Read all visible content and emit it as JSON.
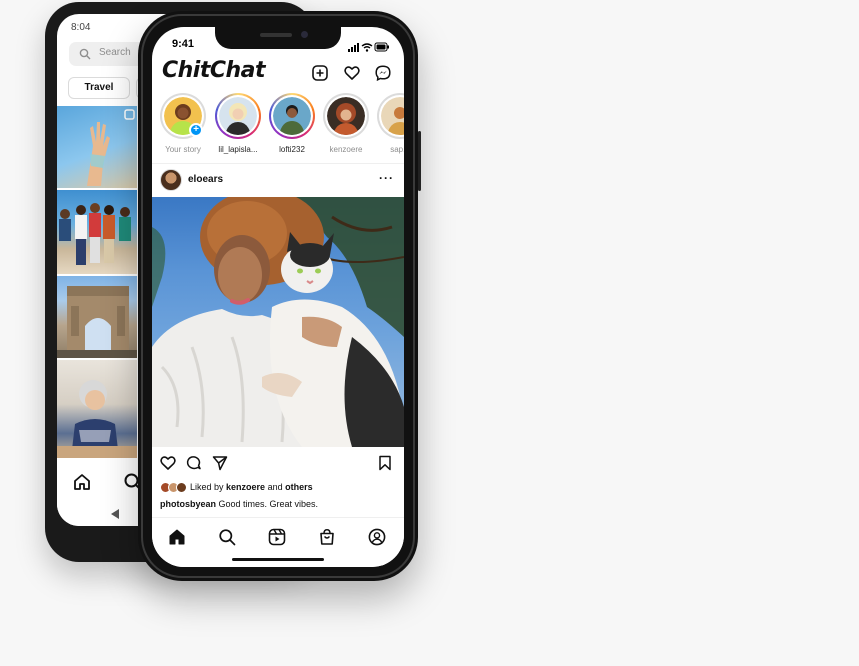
{
  "back_phone": {
    "status_time": "8:04",
    "search": {
      "placeholder": "Search",
      "icon": "search-icon"
    },
    "chips": [
      {
        "label": "Travel"
      }
    ],
    "nav_icons": [
      "home-icon",
      "search-icon",
      "back-triangle-icon"
    ]
  },
  "front_phone": {
    "status_time": "9:41",
    "app_title": "ChitChat",
    "header_icons": [
      "new-post-icon",
      "heart-icon",
      "messenger-icon"
    ],
    "stories": [
      {
        "label": "Your story",
        "own": true
      },
      {
        "label": "lil_lapisla..."
      },
      {
        "label": "lofti232"
      },
      {
        "label": "kenzoere"
      },
      {
        "label": "sap..."
      }
    ],
    "post": {
      "username": "eloears",
      "more": "···",
      "liked_prefix": "Liked by ",
      "liked_user": "kenzoere",
      "liked_middle": " and ",
      "liked_suffix": "others",
      "caption_user": "photosbyean",
      "caption_text": " Good times. Great vibes."
    },
    "tab_icons": [
      "home-icon",
      "search-icon",
      "reels-icon",
      "shop-icon",
      "profile-icon"
    ],
    "colors": {
      "accent": "#0095f6",
      "text": "#111111",
      "muted": "#8e8e8e"
    }
  }
}
